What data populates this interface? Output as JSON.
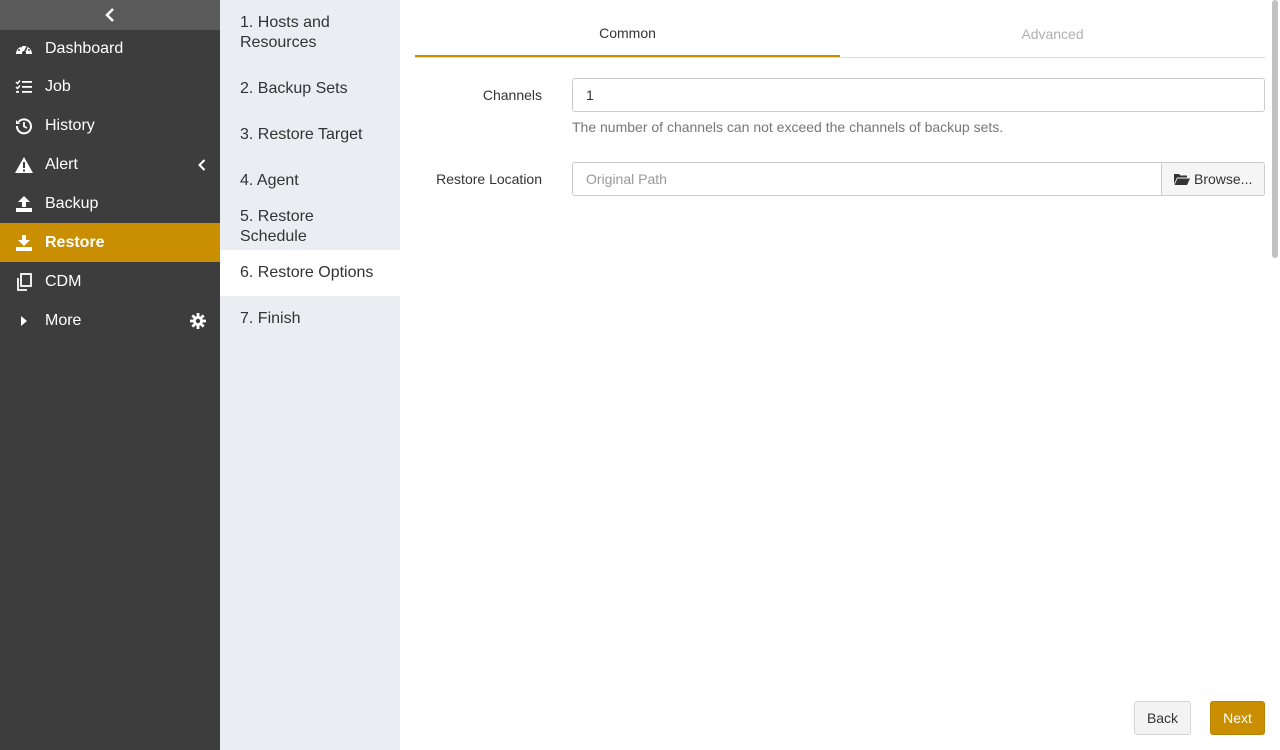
{
  "sidebar": {
    "collapse_icon": "chevron-left-icon",
    "items": [
      {
        "label": "Dashboard",
        "icon": "dashboard-icon"
      },
      {
        "label": "Job",
        "icon": "task-list-icon"
      },
      {
        "label": "History",
        "icon": "history-icon"
      },
      {
        "label": "Alert",
        "icon": "warning-icon"
      },
      {
        "label": "Backup",
        "icon": "upload-icon"
      },
      {
        "label": "Restore",
        "icon": "download-icon"
      },
      {
        "label": "CDM",
        "icon": "copy-icon"
      },
      {
        "label": "More",
        "icon": "caret-right-icon"
      }
    ],
    "active_color": "#c98f00",
    "background": "#3d3d3d"
  },
  "steps": [
    "1. Hosts and Resources",
    "2. Backup Sets",
    "3. Restore Target",
    "4. Agent",
    "5. Restore Schedule",
    "6. Restore Options",
    "7. Finish"
  ],
  "tabs": {
    "common": "Common",
    "advanced": "Advanced"
  },
  "form": {
    "channels_label": "Channels",
    "channels_value": "1",
    "channels_help": "The number of channels can not exceed the channels of backup sets.",
    "restore_location_label": "Restore Location",
    "restore_location_placeholder": "Original Path",
    "browse_label": "Browse..."
  },
  "footer": {
    "back_label": "Back",
    "next_label": "Next"
  },
  "accent_color": "#c98f00"
}
